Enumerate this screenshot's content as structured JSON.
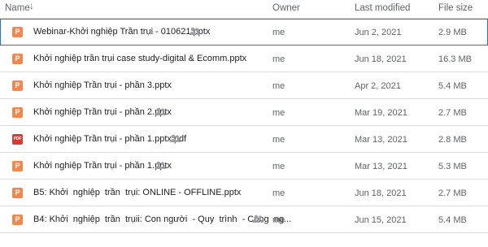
{
  "columns": {
    "name": "Name",
    "sort_arrow": "↓",
    "owner": "Owner",
    "last_modified": "Last modified",
    "file_size": "File size"
  },
  "files": [
    {
      "name": "Webinar-Khởi nghiệp Trần trụi - 010621.pptx",
      "type": "pptx",
      "icon_text": "P",
      "shared": true,
      "owner": "me",
      "modified": "Jun 2, 2021",
      "size": "2.9 MB"
    },
    {
      "name": "Khởi nghiệp trần trụi case study-digital & Ecomm.pptx",
      "type": "pptx",
      "icon_text": "P",
      "shared": false,
      "owner": "me",
      "modified": "Jun 18, 2021",
      "size": "16.3 MB"
    },
    {
      "name": "Khởi nghiệp Trần trụi - phần 3.pptx",
      "type": "pptx",
      "icon_text": "P",
      "shared": false,
      "owner": "me",
      "modified": "Apr 2, 2021",
      "size": "5.4 MB"
    },
    {
      "name": "Khởi nghiệp Trần trụi - phần 2.pptx",
      "type": "pptx",
      "icon_text": "P",
      "shared": true,
      "owner": "me",
      "modified": "Mar 19, 2021",
      "size": "2.7 MB"
    },
    {
      "name": "Khởi nghiệp Trần trụi - phần 1.pptx.pdf",
      "type": "pdf",
      "icon_text": "PDF",
      "shared": true,
      "owner": "me",
      "modified": "Mar 13, 2021",
      "size": "2.8 MB"
    },
    {
      "name": "Khởi nghiệp Trần trụi - phần 1.pptx",
      "type": "pptx",
      "icon_text": "P",
      "shared": true,
      "owner": "me",
      "modified": "Mar 13, 2021",
      "size": "5.3 MB"
    },
    {
      "name": "B5: Khởi  nghiệp  trần  trụi: ONLINE - OFFLINE.pptx",
      "type": "pptx",
      "icon_text": "P",
      "shared": false,
      "owner": "me",
      "modified": "Jun 18, 2021",
      "size": "2.7 MB"
    },
    {
      "name": "B4: Khởi  nghiệp  trần  trụii: Con người  - Quy  trình  - Công  ng...",
      "type": "pptx",
      "icon_text": "P",
      "shared": true,
      "owner": "me",
      "modified": "Jun 15, 2021",
      "size": "5.4 MB"
    }
  ]
}
